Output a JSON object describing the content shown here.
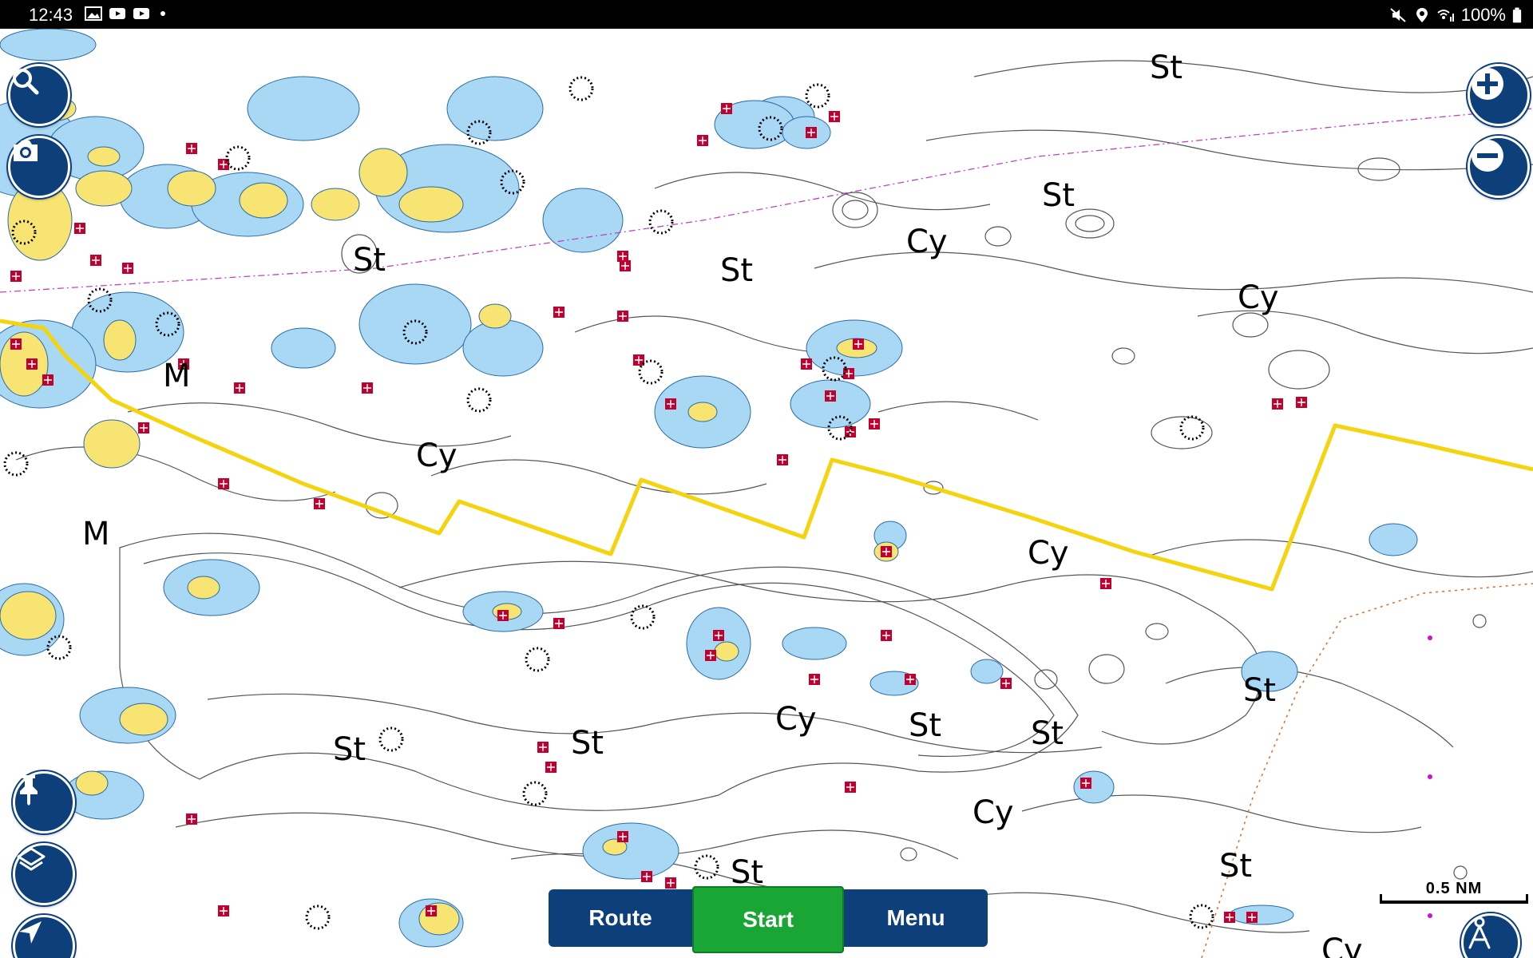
{
  "status_bar": {
    "time": "12:43",
    "battery": "100%",
    "left_icons": [
      "image-icon",
      "youtube-icon",
      "youtube-icon",
      "dot-icon"
    ],
    "right_icons": [
      "mute-icon",
      "location-icon",
      "wifi-signal-icon",
      "battery-icon"
    ]
  },
  "map": {
    "route_color": "#f4d30f",
    "land_color": "#f8e473",
    "shallow_color": "#a9d8f5",
    "hazard_color": "#c2002f",
    "bottom_labels": {
      "st": "St",
      "cy": "Cy",
      "m": "M"
    }
  },
  "controls": {
    "search_icon": "search-icon",
    "camera_icon": "camera-icon",
    "zoom_in_icon": "plus-icon",
    "zoom_out_icon": "minus-icon",
    "pin_icon": "pushpin-icon",
    "layers_icon": "layers-icon",
    "locate_icon": "navigation-arrow-icon",
    "autopilot_icon": "autoguidance-icon"
  },
  "bottom_bar": {
    "route_label": "Route",
    "start_label": "Start",
    "menu_label": "Menu",
    "start_color": "#1aa634",
    "nav_color": "#0d3f7a"
  },
  "scale": {
    "label": "0.5 NM"
  }
}
